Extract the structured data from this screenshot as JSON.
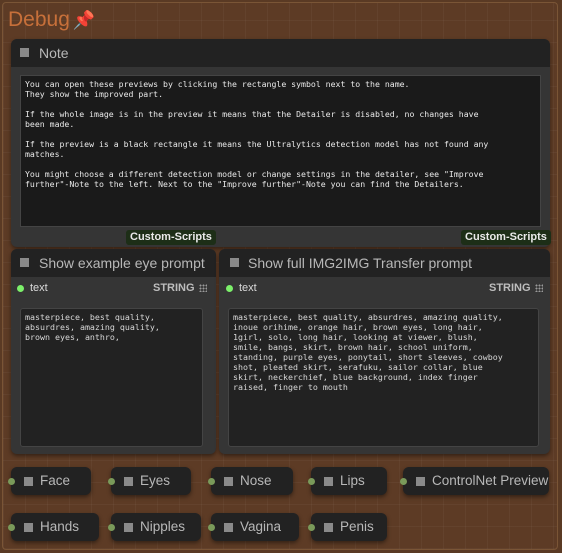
{
  "group": {
    "title": "Debug",
    "pin_icon": "pushpin-icon"
  },
  "note": {
    "title": "Note",
    "paragraphs": [
      "You can open these previews by clicking the rectangle symbol next to the name.\nThey show the improved part.",
      "If the whole image is in the preview it means that the Detailer is disabled, no changes have\nbeen made.",
      "If the preview is a black rectangle it means the Ultralytics detection model has not found any\nmatches.",
      "You might choose a different detection model or change settings in the detailer, see \"Improve\nfurther\"-Note to the left. Next to the \"Improve further\"-Note you can find the Detailers."
    ],
    "badge_left": "Custom-Scripts",
    "badge_right": "Custom-Scripts"
  },
  "eye_prompt": {
    "title": "Show example eye prompt",
    "slot_label": "text",
    "slot_type": "STRING",
    "text": "masterpiece, best quality,\nabsurdres, amazing quality,\nbrown eyes, anthro,"
  },
  "img2img_prompt": {
    "title": "Show full IMG2IMG Transfer prompt",
    "slot_label": "text",
    "slot_type": "STRING",
    "text": "masterpiece, best quality, absurdres, amazing quality,\ninoue orihime, orange hair, brown eyes, long hair,\n1girl, solo, long hair, looking at viewer, blush,\nsmile, bangs, skirt, brown hair, school uniform,\nstanding, purple eyes, ponytail, short sleeves, cowboy\nshot, pleated skirt, serafuku, sailor collar, blue\nskirt, neckerchief, blue background, index finger\nraised, finger to mouth"
  },
  "preview_nodes_row1": [
    "Face",
    "Eyes",
    "Nose",
    "Lips",
    "ControlNet Preview"
  ],
  "preview_nodes_row2": [
    "Hands",
    "Nipples",
    "Vagina",
    "Penis"
  ],
  "colors": {
    "accent": "#c7703a",
    "slot_green": "#7cf06a",
    "badge_bg": "#1d2e17",
    "canvas": "#5d3b25"
  }
}
